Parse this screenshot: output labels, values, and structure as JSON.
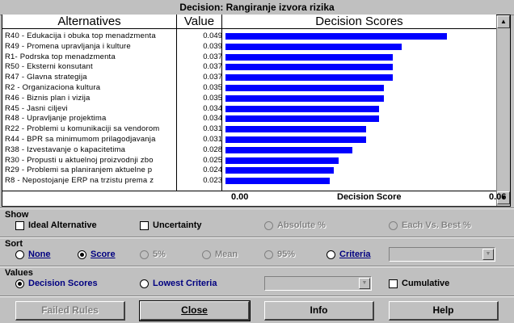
{
  "title": "Decision: Rangiranje izvora rizika",
  "table": {
    "col_alternatives": "Alternatives",
    "col_value": "Value",
    "col_scores": "Decision Scores",
    "axis_min": "0.00",
    "axis_label": "Decision Score",
    "axis_max": "0.06"
  },
  "chart_data": {
    "type": "bar",
    "xlim": [
      0,
      0.06
    ],
    "categories": [
      "R40 - Edukacija i obuka top menadzmenta",
      "R49 - Promena upravljanja i kulture",
      "R1- Podrska top menadzmenta",
      "R50 - Eksterni konsutant",
      "R47 - Glavna strategija",
      "R2 - Organizaciona kultura",
      "R46 - Biznis plan i vizija",
      "R45 - Jasni ciljevi",
      "R48 - Upravljanje projektima",
      "R22 - Problemi u komunikaciji sa vendorom",
      "R44 - BPR sa minimumom prilagodjavanja",
      "R38 - Izvestavanje o kapacitetima",
      "R30 - Propusti u aktuelnoj proizvodnji zbo",
      "R29 - Problemi sa planiranjem aktuelne p",
      "R8 - Nepostojanje ERP na trzistu prema z"
    ],
    "values": [
      "0.049",
      "0.039",
      "0.037",
      "0.037",
      "0.037",
      "0.035",
      "0.035",
      "0.034",
      "0.034",
      "0.031",
      "0.031",
      "0.028",
      "0.025",
      "0.024",
      "0.023"
    ]
  },
  "show": {
    "label": "Show",
    "ideal": "Ideal Alternative",
    "uncertainty": "Uncertainty",
    "absolute": "Absolute %",
    "each_vs_best": "Each Vs. Best %"
  },
  "sort": {
    "label": "Sort",
    "none": "None",
    "score": "Score",
    "pct5": "5%",
    "mean": "Mean",
    "pct95": "95%",
    "criteria": "Criteria"
  },
  "values_group": {
    "label": "Values",
    "decision_scores": "Decision Scores",
    "lowest_criteria": "Lowest Criteria",
    "cumulative": "Cumulative"
  },
  "buttons": {
    "failed_rules": "Failed Rules",
    "close": "Close",
    "info": "Info",
    "help": "Help"
  },
  "colors": {
    "bar": "#0000ff",
    "background": "#c0c0c0"
  }
}
